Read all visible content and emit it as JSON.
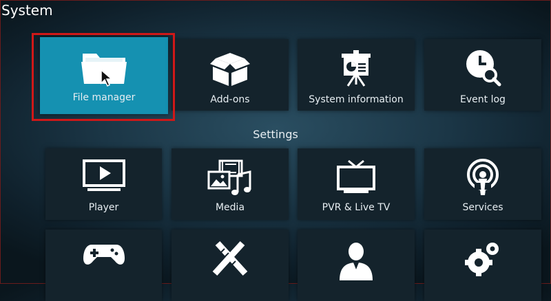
{
  "window": {
    "title": "System"
  },
  "top_tiles": [
    {
      "label": "File manager",
      "icon": "folder-icon",
      "focused": true
    },
    {
      "label": "Add-ons",
      "icon": "open-box-icon"
    },
    {
      "label": "System information",
      "icon": "presentation-board-icon"
    },
    {
      "label": "Event log",
      "icon": "clock-search-icon"
    }
  ],
  "settings": {
    "title": "Settings",
    "tiles": [
      {
        "label": "Player",
        "icon": "player-screen-icon"
      },
      {
        "label": "Media",
        "icon": "media-film-music-icon"
      },
      {
        "label": "PVR & Live TV",
        "icon": "tv-antenna-icon"
      },
      {
        "label": "Services",
        "icon": "broadcast-icon"
      },
      {
        "label": "",
        "icon": "gamepad-icon"
      },
      {
        "label": "",
        "icon": "pencil-ruler-icon"
      },
      {
        "label": "",
        "icon": "user-profile-icon"
      },
      {
        "label": "",
        "icon": "gears-icon"
      }
    ]
  },
  "colors": {
    "focus": "#1591b1",
    "tile": "#14232c",
    "highlight_box": "#d01818"
  }
}
